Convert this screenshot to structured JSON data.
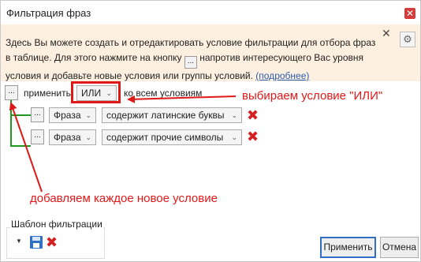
{
  "window": {
    "title": "Фильтрация фраз",
    "close_glyph": "✕"
  },
  "info": {
    "text_part1": "Здесь Вы можете создать и отредактировать условие фильтрации для отбора фраз в таблице. Для этого нажмите на кнопку",
    "button_glyph": "...",
    "text_part2": "напротив интересующего Вас уровня условия и добавьте новые условия или группы условий.",
    "link": "(подробнее)",
    "close_glyph": "✕",
    "gear_glyph": "⚙"
  },
  "apply_row": {
    "dots": "...",
    "apply_label": "применить",
    "operator_value": "ИЛИ",
    "to_all_label": "ко всем условиям"
  },
  "conditions": [
    {
      "dots": "...",
      "field": "Фраза",
      "operator": "содержит латинские буквы"
    },
    {
      "dots": "...",
      "field": "Фраза",
      "operator": "содержит прочие символы"
    }
  ],
  "annotations": {
    "choose_or": "выбираем условие \"ИЛИ\"",
    "add_each": "добавляем каждое новое условие"
  },
  "template": {
    "title": "Шаблон фильтрации"
  },
  "buttons": {
    "apply": "Применить",
    "cancel": "Отмена"
  },
  "colors": {
    "annotation": "#e01818",
    "tree": "#1e9a1e",
    "info_bg": "#fdf0e0",
    "link": "#2a5db0"
  }
}
